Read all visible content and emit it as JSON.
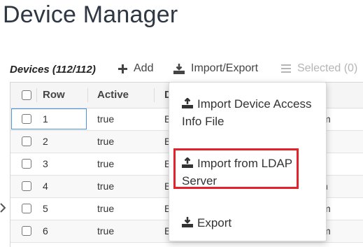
{
  "page": {
    "title": "Device Manager"
  },
  "toolbar": {
    "devices_label": "Devices (112/112)",
    "add_label": "Add",
    "import_export_label": "Import/Export",
    "selected_label": "Selected (0)"
  },
  "grid": {
    "columns": [
      "Row",
      "Active",
      "D"
    ],
    "rows": [
      {
        "row": "1",
        "active": "true",
        "d": "B",
        "tail": "m"
      },
      {
        "row": "2",
        "active": "true",
        "d": "B",
        "tail": ""
      },
      {
        "row": "3",
        "active": "true",
        "d": "B",
        "tail": ""
      },
      {
        "row": "4",
        "active": "true",
        "d": "B",
        "tail": "n"
      },
      {
        "row": "5",
        "active": "true",
        "d": "B",
        "tail": "m"
      },
      {
        "row": "6",
        "active": "true",
        "d": "B",
        "tail": "m"
      }
    ]
  },
  "menu": {
    "items": [
      {
        "line1": "Import Device Access",
        "line2": "Info File"
      },
      {
        "line1": "Import from LDAP",
        "line2": "Server"
      },
      {
        "line1": "Export",
        "line2": ""
      }
    ]
  },
  "colors": {
    "highlight": "#e3232c",
    "focus": "#4a90e2"
  },
  "icons": [
    "plus-icon",
    "upload-tray-icon",
    "list-icon",
    "upload-icon",
    "download-icon",
    "chevron-right-icon"
  ]
}
